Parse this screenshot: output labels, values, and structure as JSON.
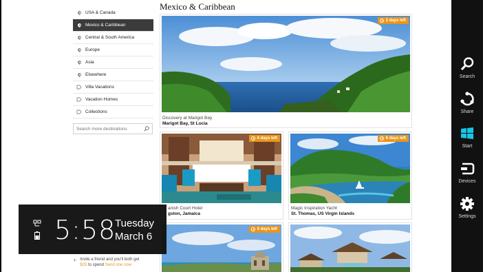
{
  "sidebar": {
    "items": [
      {
        "label": "USA & Canada",
        "icon": "pin-icon"
      },
      {
        "label": "Mexico & Caribbean",
        "icon": "pin-icon",
        "active": true
      },
      {
        "label": "Central & South America",
        "icon": "pin-icon"
      },
      {
        "label": "Europe",
        "icon": "pin-icon"
      },
      {
        "label": "Asia",
        "icon": "pin-icon"
      },
      {
        "label": "Elsewhere",
        "icon": "pin-icon"
      },
      {
        "label": "Villa Vacations",
        "icon": "tag-icon"
      },
      {
        "label": "Vacation Homes",
        "icon": "tag-icon"
      },
      {
        "label": "Collections",
        "icon": "tag-icon"
      }
    ],
    "search_placeholder": "Search more destinations"
  },
  "main": {
    "title": "Mexico & Caribbean",
    "featured": {
      "badge": "2 days left",
      "subtitle": "Discovery at Marigot Bay",
      "location": "Marigot Bay, St Lucia"
    },
    "cards": [
      {
        "badge": "4 days left",
        "subtitle": "anish Court Hotel",
        "location": "gston, Jamaica"
      },
      {
        "badge": "6 days left",
        "subtitle": "Magic Inspiration Yacht",
        "location": "St. Thomas, US Virgin Islands"
      },
      {
        "badge": "5 days left"
      },
      {}
    ]
  },
  "invite": {
    "line1": "Invite a friend and you'll both get",
    "amount": "$25",
    "to_spend": " to spend ",
    "link": "Send one now"
  },
  "charms": [
    {
      "label": "Search",
      "icon": "search-icon"
    },
    {
      "label": "Share",
      "icon": "share-icon"
    },
    {
      "label": "Start",
      "icon": "windows-logo-icon"
    },
    {
      "label": "Devices",
      "icon": "devices-icon"
    },
    {
      "label": "Settings",
      "icon": "gear-icon"
    }
  ],
  "clock": {
    "time": "5:58",
    "day": "Tuesday",
    "date": "March 6"
  },
  "colors": {
    "accent": "#e8951c",
    "active_nav": "#3b3b3b",
    "charms_bg": "#111111"
  }
}
